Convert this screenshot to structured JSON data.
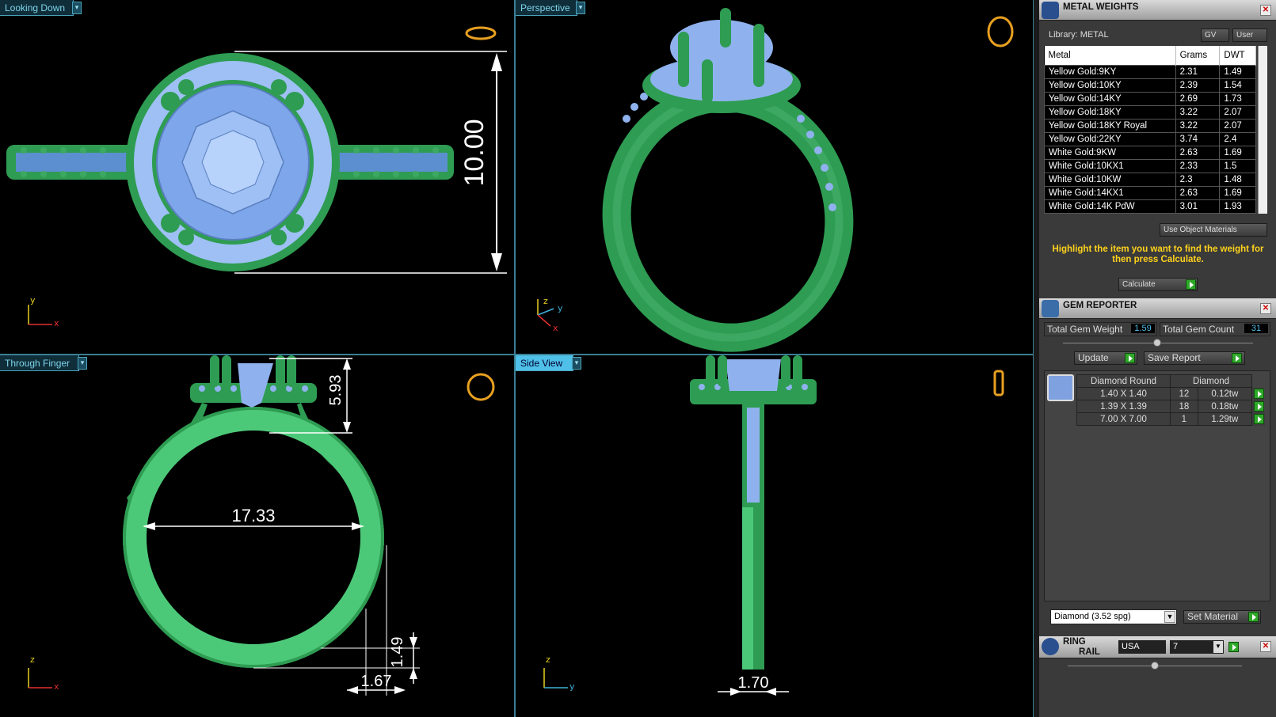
{
  "viewports": {
    "top_left": {
      "label": "Looking Down",
      "dimension": "10.00"
    },
    "top_right": {
      "label": "Perspective"
    },
    "bottom_left": {
      "label": "Through Finger",
      "dim_height": "5.93",
      "dim_inner": "17.33",
      "dim_shank_h": "1.49",
      "dim_shank_w": "1.67"
    },
    "bottom_right": {
      "label": "Side View",
      "dim_width": "1.70"
    }
  },
  "axes": {
    "top_left": {
      "v": "y",
      "h": "x"
    },
    "top_right": {
      "v": "z",
      "d": "y",
      "h": "x"
    },
    "bottom_left": {
      "v": "z",
      "h": "x"
    },
    "bottom_right": {
      "v": "z",
      "h": "y"
    }
  },
  "metal_weights": {
    "title": "METAL WEIGHTS",
    "library": "Library: METAL",
    "gv_label": "GV",
    "user_label": "User",
    "columns": [
      "Metal",
      "Grams",
      "DWT"
    ],
    "rows": [
      [
        "Yellow Gold:9KY",
        "2.31",
        "1.49"
      ],
      [
        "Yellow Gold:10KY",
        "2.39",
        "1.54"
      ],
      [
        "Yellow Gold:14KY",
        "2.69",
        "1.73"
      ],
      [
        "Yellow Gold:18KY",
        "3.22",
        "2.07"
      ],
      [
        "Yellow Gold:18KY Royal",
        "3.22",
        "2.07"
      ],
      [
        "Yellow Gold:22KY",
        "3.74",
        "2.4"
      ],
      [
        "White Gold:9KW",
        "2.63",
        "1.69"
      ],
      [
        "White Gold:10KX1",
        "2.33",
        "1.5"
      ],
      [
        "White Gold:10KW",
        "2.3",
        "1.48"
      ],
      [
        "White Gold:14KX1",
        "2.63",
        "1.69"
      ],
      [
        "White Gold:14K PdW",
        "3.01",
        "1.93"
      ]
    ],
    "use_object_materials": "Use Object Materials",
    "hint": "Highlight the item you want to find the weight for then press Calculate.",
    "calculate": "Calculate"
  },
  "gem_reporter": {
    "title": "GEM REPORTER",
    "total_weight_label": "Total Gem Weight",
    "total_weight": "1.59",
    "total_count_label": "Total Gem Count",
    "total_count": "31",
    "update": "Update",
    "save_report": "Save Report",
    "columns": [
      "Diamond Round",
      "Diamond"
    ],
    "rows": [
      [
        "1.40 X 1.40",
        "12",
        "0.12tw"
      ],
      [
        "1.39 X 1.39",
        "18",
        "0.18tw"
      ],
      [
        "7.00 X 7.00",
        "1",
        "1.29tw"
      ]
    ],
    "material_select": "Diamond    (3.52 spg)",
    "set_material": "Set Material"
  },
  "ring_rail": {
    "title_line1": "RING",
    "title_line2": "RAIL",
    "country": "USA",
    "size": "7"
  },
  "colors": {
    "metal": "#2e9c52",
    "metal_light": "#5fd88a",
    "gem": "#8fb2ee",
    "dim": "#ffffff",
    "accent": "#4fc0e8",
    "hint": "#ffd21c"
  }
}
